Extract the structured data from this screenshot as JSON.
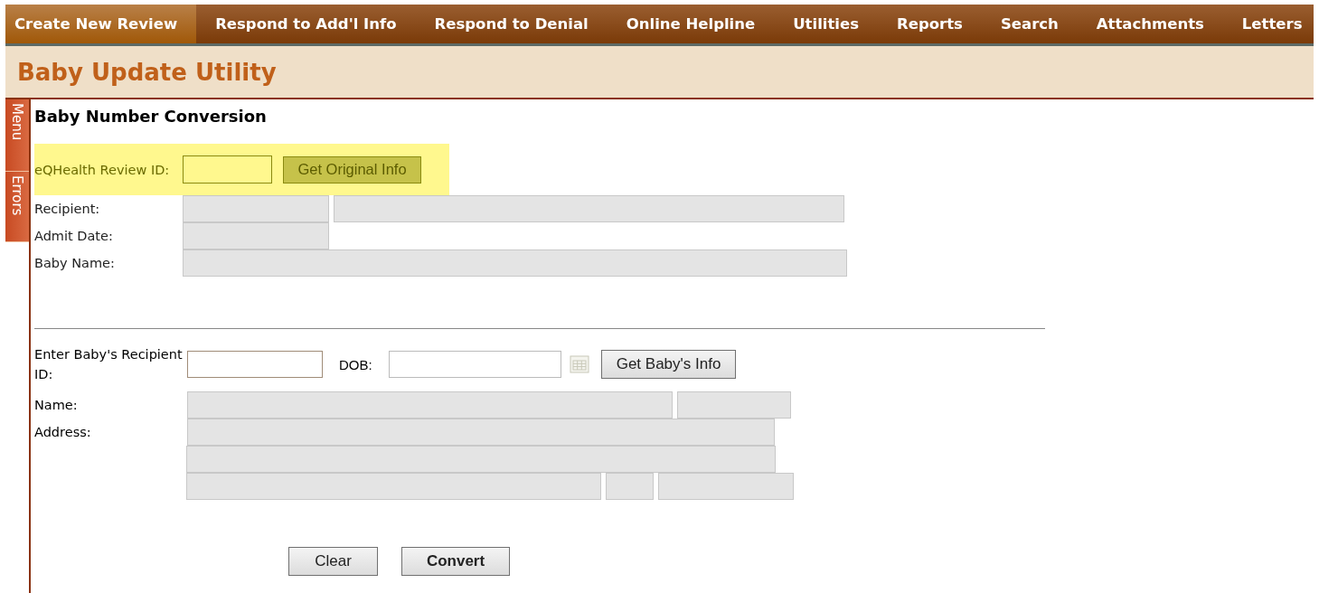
{
  "nav": [
    {
      "label": "Create New Review",
      "selected": true
    },
    {
      "label": "Respond to Add'l Info",
      "selected": false
    },
    {
      "label": "Respond to Denial",
      "selected": false
    },
    {
      "label": "Online Helpline",
      "selected": false
    },
    {
      "label": "Utilities",
      "selected": false
    },
    {
      "label": "Reports",
      "selected": false
    },
    {
      "label": "Search",
      "selected": false
    },
    {
      "label": "Attachments",
      "selected": false
    },
    {
      "label": "Letters",
      "selected": false
    }
  ],
  "page_title": "Baby Update Utility",
  "side_tabs": [
    "Menu",
    "Errors"
  ],
  "section_title": "Baby Number Conversion",
  "review_lookup": {
    "label": "eQHealth Review ID:",
    "highlighted": true,
    "button": "Get Original Info"
  },
  "original_info": [
    {
      "label": "Recipient:",
      "disabled": true
    },
    {
      "label": "Admit Date:",
      "disabled": true
    },
    {
      "label": "Baby Name:",
      "disabled": true
    }
  ],
  "baby_lookup": {
    "label": "Enter Baby's Recipient ID:",
    "dob_label": "DOB:",
    "button": "Get Baby's Info"
  },
  "baby_info": [
    {
      "label": "Name:",
      "disabled": true
    },
    {
      "label": "Address:",
      "disabled": true
    }
  ],
  "actions": [
    {
      "label": "Clear",
      "default": false
    },
    {
      "label": "Convert",
      "default": true
    }
  ]
}
